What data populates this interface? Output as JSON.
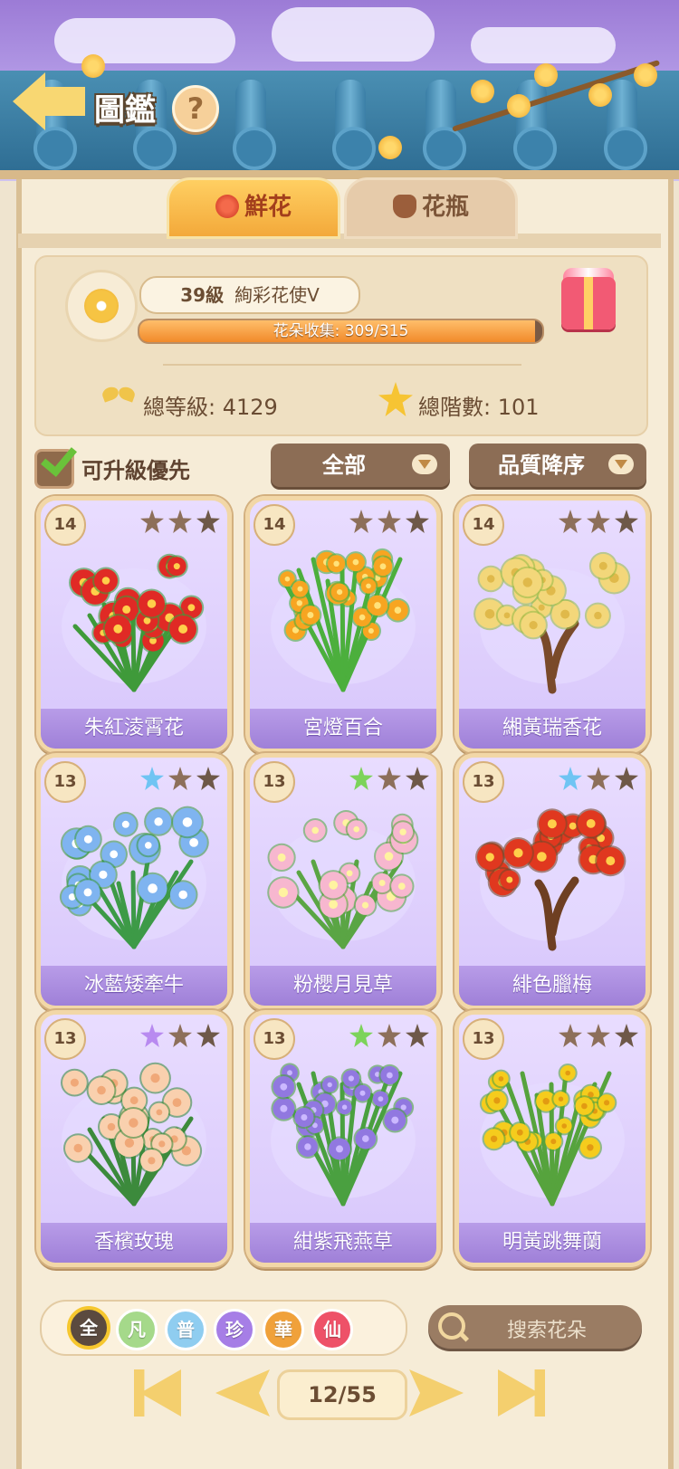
{
  "header": {
    "title": "圖鑑",
    "help_symbol": "?"
  },
  "tabs": [
    {
      "label": "鮮花",
      "active": true
    },
    {
      "label": "花瓶",
      "active": false
    }
  ],
  "profile": {
    "level": "39級",
    "rank_title": "絢彩花使Ⅴ",
    "collection_label": "花朵收集: 309/315",
    "collection_progress": 0.981,
    "total_level_label": "總等級: 4129",
    "total_tier_label": "總階數: 101"
  },
  "filters": {
    "upgrade_first_label": "可升級優先",
    "upgrade_first_checked": true,
    "category_selected": "全部",
    "sort_selected": "品質降序"
  },
  "cards": [
    {
      "level": "14",
      "name": "朱紅淩霄花",
      "star_colors": [
        "#8d6f5a",
        "#8d6f5a",
        "#6e5848"
      ],
      "palette": "red-vine"
    },
    {
      "level": "14",
      "name": "宮燈百合",
      "star_colors": [
        "#8d6f5a",
        "#8d6f5a",
        "#6e5848"
      ],
      "palette": "orange-lily"
    },
    {
      "level": "14",
      "name": "緗黃瑞香花",
      "star_colors": [
        "#8d6f5a",
        "#8d6f5a",
        "#6e5848"
      ],
      "palette": "yellow-tree"
    },
    {
      "level": "13",
      "name": "冰藍矮牽牛",
      "star_colors": [
        "#6fc4f3",
        "#8d6f5a",
        "#6e5848"
      ],
      "palette": "blue-petunia"
    },
    {
      "level": "13",
      "name": "粉櫻月見草",
      "star_colors": [
        "#7cd35a",
        "#8d6f5a",
        "#6e5848"
      ],
      "palette": "pink-primrose"
    },
    {
      "level": "13",
      "name": "緋色臘梅",
      "star_colors": [
        "#6fc4f3",
        "#8d6f5a",
        "#6e5848"
      ],
      "palette": "red-plum"
    },
    {
      "level": "13",
      "name": "香檳玫瑰",
      "star_colors": [
        "#b88af0",
        "#8d6f5a",
        "#6e5848"
      ],
      "palette": "peach-rose"
    },
    {
      "level": "13",
      "name": "紺紫飛燕草",
      "star_colors": [
        "#7cd35a",
        "#8d6f5a",
        "#6e5848"
      ],
      "palette": "purple-larkspur"
    },
    {
      "level": "13",
      "name": "明黃跳舞蘭",
      "star_colors": [
        "#8d6f5a",
        "#8d6f5a",
        "#6e5848"
      ],
      "palette": "yellow-orchid"
    }
  ],
  "rarity_filters": [
    {
      "label": "全",
      "color": "#5b4a3f",
      "selected": true
    },
    {
      "label": "凡",
      "color": "#a5d98a",
      "selected": false
    },
    {
      "label": "普",
      "color": "#8fcdf0",
      "selected": false
    },
    {
      "label": "珍",
      "color": "#a67ee6",
      "selected": false
    },
    {
      "label": "華",
      "color": "#f0a13a",
      "selected": false
    },
    {
      "label": "仙",
      "color": "#ee5168",
      "selected": false
    }
  ],
  "search": {
    "placeholder": "搜索花朵"
  },
  "pagination": {
    "current": 12,
    "total": 55,
    "label": "12/55"
  }
}
